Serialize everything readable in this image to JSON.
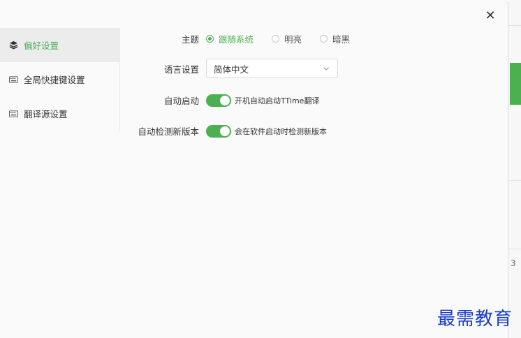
{
  "dialog": {
    "close_label": "✕"
  },
  "sidebar": {
    "items": [
      {
        "label": "偏好设置",
        "icon": "layers-icon",
        "active": true
      },
      {
        "label": "全局快捷键设置",
        "icon": "keyboard-icon",
        "active": false
      },
      {
        "label": "翻译源设置",
        "icon": "keyboard-icon",
        "active": false
      }
    ]
  },
  "form": {
    "theme": {
      "label": "主题",
      "options": [
        {
          "label": "跟随系统",
          "selected": true
        },
        {
          "label": "明亮",
          "selected": false
        },
        {
          "label": "暗黑",
          "selected": false
        }
      ]
    },
    "language": {
      "label": "语言设置",
      "value": "简体中文"
    },
    "autostart": {
      "label": "自动启动",
      "on": true,
      "text": "开机自动启动TTime翻译"
    },
    "autoupdate": {
      "label": "自动检测新版本",
      "on": true,
      "text": "会在软件启动时检测新版本"
    }
  },
  "colors": {
    "accent": "#4caf50",
    "watermark": "#1a3ec9"
  },
  "watermark": "最需教育",
  "background_app": {
    "partial_char": "3"
  }
}
